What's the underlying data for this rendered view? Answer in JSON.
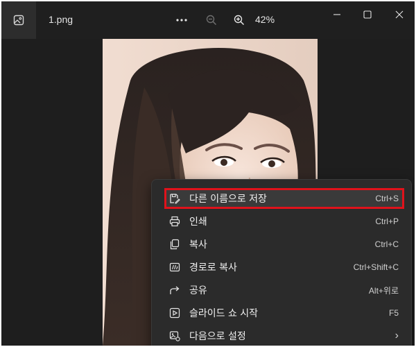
{
  "titlebar": {
    "filename": "1.png",
    "zoom": "42%"
  },
  "icons": {
    "app": "image-icon",
    "more": "more-dots-icon",
    "zoom_out": "zoom-out-icon",
    "zoom_in": "zoom-in-icon",
    "minimize": "minimize-icon",
    "maximize": "maximize-icon",
    "close": "close-icon"
  },
  "context_menu": {
    "items": [
      {
        "label": "다른 이름으로 저장",
        "shortcut": "Ctrl+S",
        "icon": "save-as-icon",
        "highlighted": true
      },
      {
        "label": "인쇄",
        "shortcut": "Ctrl+P",
        "icon": "print-icon"
      },
      {
        "label": "복사",
        "shortcut": "Ctrl+C",
        "icon": "copy-icon"
      },
      {
        "label": "경로로 복사",
        "shortcut": "Ctrl+Shift+C",
        "icon": "copy-path-icon"
      },
      {
        "label": "공유",
        "shortcut": "Alt+위로",
        "icon": "share-icon"
      },
      {
        "label": "슬라이드 쇼 시작",
        "shortcut": "F5",
        "icon": "slideshow-icon"
      },
      {
        "label": "다음으로 설정",
        "shortcut": "›",
        "icon": "set-as-icon"
      }
    ]
  },
  "colors": {
    "background": "#1e1e1e",
    "menu_background": "#2b2b2b",
    "highlight_border": "#e0121b"
  }
}
